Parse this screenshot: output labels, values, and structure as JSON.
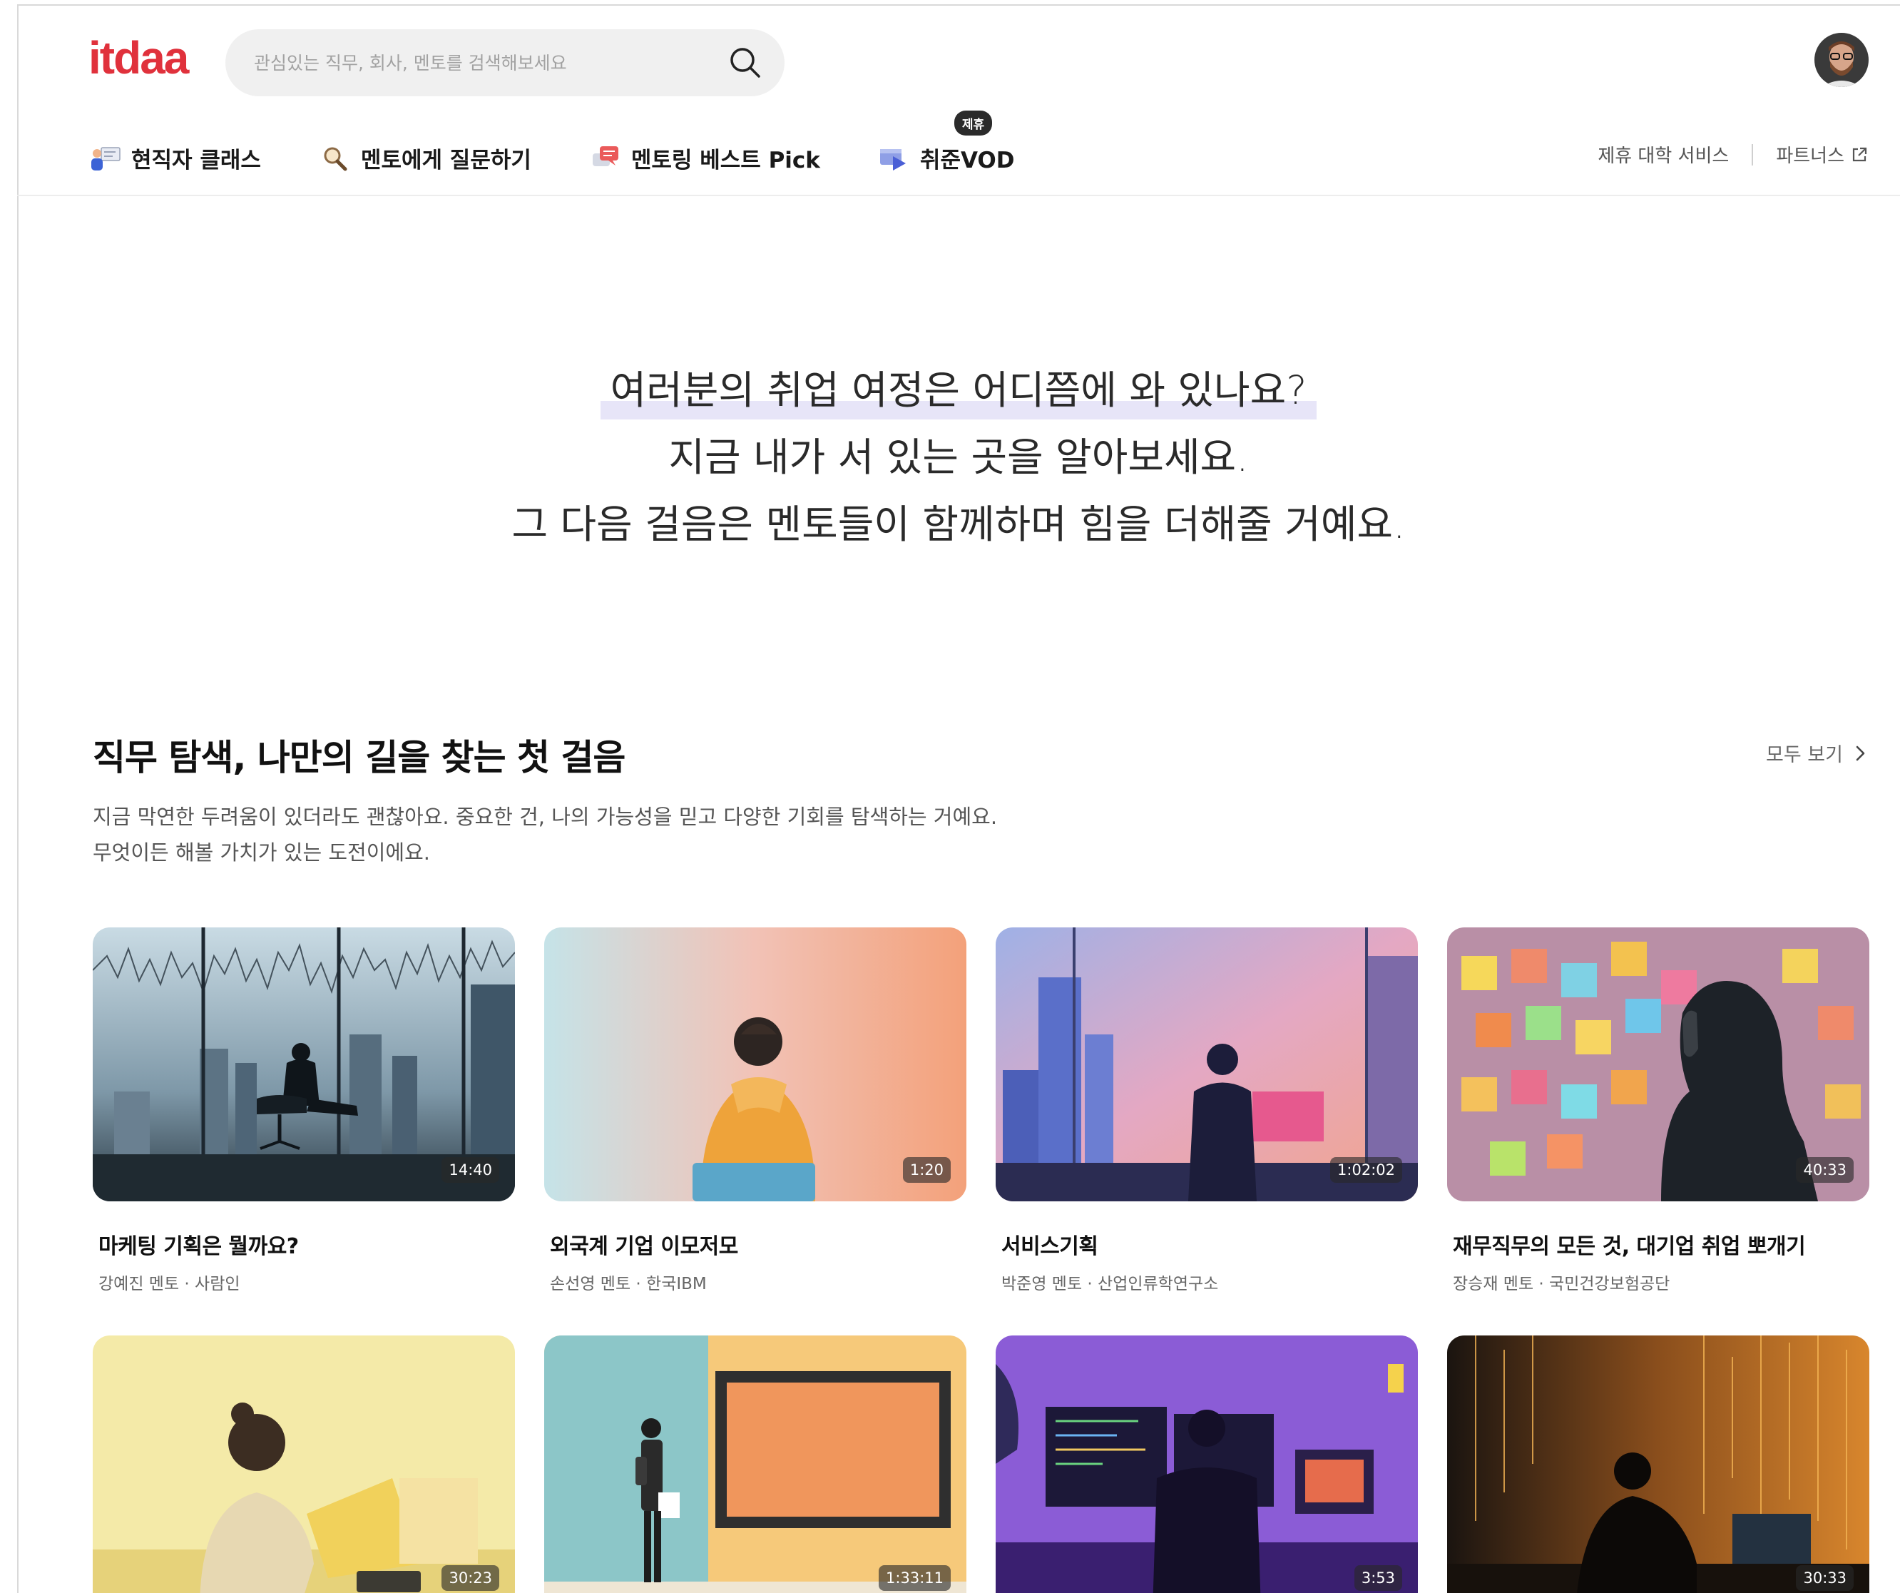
{
  "brand": {
    "logo_text": "itdaa",
    "logo_color": "#e0313c"
  },
  "search": {
    "placeholder": "관심있는 직무, 회사, 멘토를 검색해보세요",
    "value": ""
  },
  "nav": {
    "items": [
      {
        "label": "현직자 클래스",
        "icon": "class-icon"
      },
      {
        "label": "멘토에게 질문하기",
        "icon": "magnifier-icon"
      },
      {
        "label": "멘토링 베스트 Pick",
        "icon": "chat-icon"
      },
      {
        "label": "취준VOD",
        "icon": "video-icon",
        "badge": "제휴"
      }
    ],
    "right_links": [
      "제휴 대학 서비스",
      "파트너스"
    ]
  },
  "hero": {
    "line1": "여러분의 취업 여정은 어디쯤에 와 있나요?",
    "line2": "지금 내가 서 있는 곳을 알아보세요.",
    "line3": "그 다음 걸음은 멘토들이 함께하며 힘을 더해줄 거예요."
  },
  "section": {
    "title": "직무 탐색, 나만의 길을 찾는 첫 걸음",
    "view_all": "모두 보기",
    "desc_line1": "지금 막연한 두려움이 있더라도 괜찮아요. 중요한 건, 나의 가능성을 믿고 다양한 기회를 탐색하는 거예요.",
    "desc_line2": "무엇이든 해볼 가치가 있는 도전이에요."
  },
  "cards": [
    {
      "title": "마케팅 기획은 뭘까요?",
      "mentor": "강예진 멘토 ·",
      "company": "사람인",
      "duration": "14:40"
    },
    {
      "title": "외국계 기업 이모저모",
      "mentor": "손선영 멘토 ·",
      "company": "한국IBM",
      "duration": "1:20"
    },
    {
      "title": "서비스기획",
      "mentor": "박준영 멘토 ·",
      "company": "산업인류학연구소",
      "duration": "1:02:02"
    },
    {
      "title": "재무직무의 모든 것, 대기업 취업 뽀개기",
      "mentor": "장승재 멘토 ·",
      "company": "국민건강보험공단",
      "duration": "40:33"
    },
    {
      "duration": "30:23"
    },
    {
      "duration": "1:33:11"
    },
    {
      "duration": "3:53"
    },
    {
      "duration": "30:33"
    }
  ]
}
